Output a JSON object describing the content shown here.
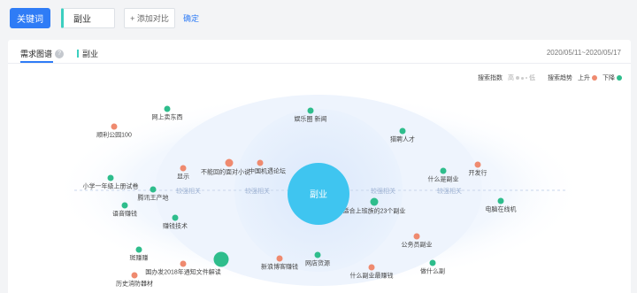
{
  "toolbar": {
    "keyword_button": "关键词",
    "keyword_value": "副业",
    "add_compare": "+ 添加对比",
    "confirm": "确定"
  },
  "card": {
    "tab_main": "需求图谱",
    "help_icon": "?",
    "tab_keyword": "副业",
    "date_range": "2020/05/11~2020/05/17",
    "legend": {
      "search_index": "搜索指数",
      "scale_high": "高",
      "scale_low": "低",
      "search_trend": "搜索趋势",
      "up": "上升",
      "down": "下降",
      "up_color": "#ef8a6f",
      "down_color": "#2ebd8c"
    },
    "center": "副业",
    "ring_labels": [
      "较强相关",
      "较强相关",
      "较强相关",
      "较强相关"
    ],
    "nodes": [
      {
        "label": "网上卖东西",
        "trend": "down"
      },
      {
        "label": "娱乐圈 新闻",
        "trend": "down"
      },
      {
        "label": "顺利公园100",
        "trend": "up"
      },
      {
        "label": "猎聘人才",
        "trend": "down"
      },
      {
        "label": "不能回的面对小说",
        "trend": "up"
      },
      {
        "label": "中国机遇论坛",
        "trend": "up"
      },
      {
        "label": "显示",
        "trend": "up"
      },
      {
        "label": "什么是副业",
        "trend": "down"
      },
      {
        "label": "开发行",
        "trend": "up"
      },
      {
        "label": "小学一年级上册试卷",
        "trend": "down"
      },
      {
        "label": "腾讯王产地",
        "trend": "down"
      },
      {
        "label": "电脑在线机",
        "trend": "down"
      },
      {
        "label": "语音赚钱",
        "trend": "down"
      },
      {
        "label": "适合上班族的23个副业",
        "trend": "down"
      },
      {
        "label": "赚钱技术",
        "trend": "down"
      },
      {
        "label": "公务员副业",
        "trend": "up"
      },
      {
        "label": "斑赚赚",
        "trend": "down"
      },
      {
        "label": "国办发2018年通知文件解读",
        "trend": "up"
      },
      {
        "label": "新浪博客赚钱",
        "trend": "up"
      },
      {
        "label": "网店货源",
        "trend": "down"
      },
      {
        "label": "什么副业最赚钱",
        "trend": "up"
      },
      {
        "label": "做什么副",
        "trend": "down"
      },
      {
        "label": "历史消防器材",
        "trend": "up"
      }
    ]
  }
}
